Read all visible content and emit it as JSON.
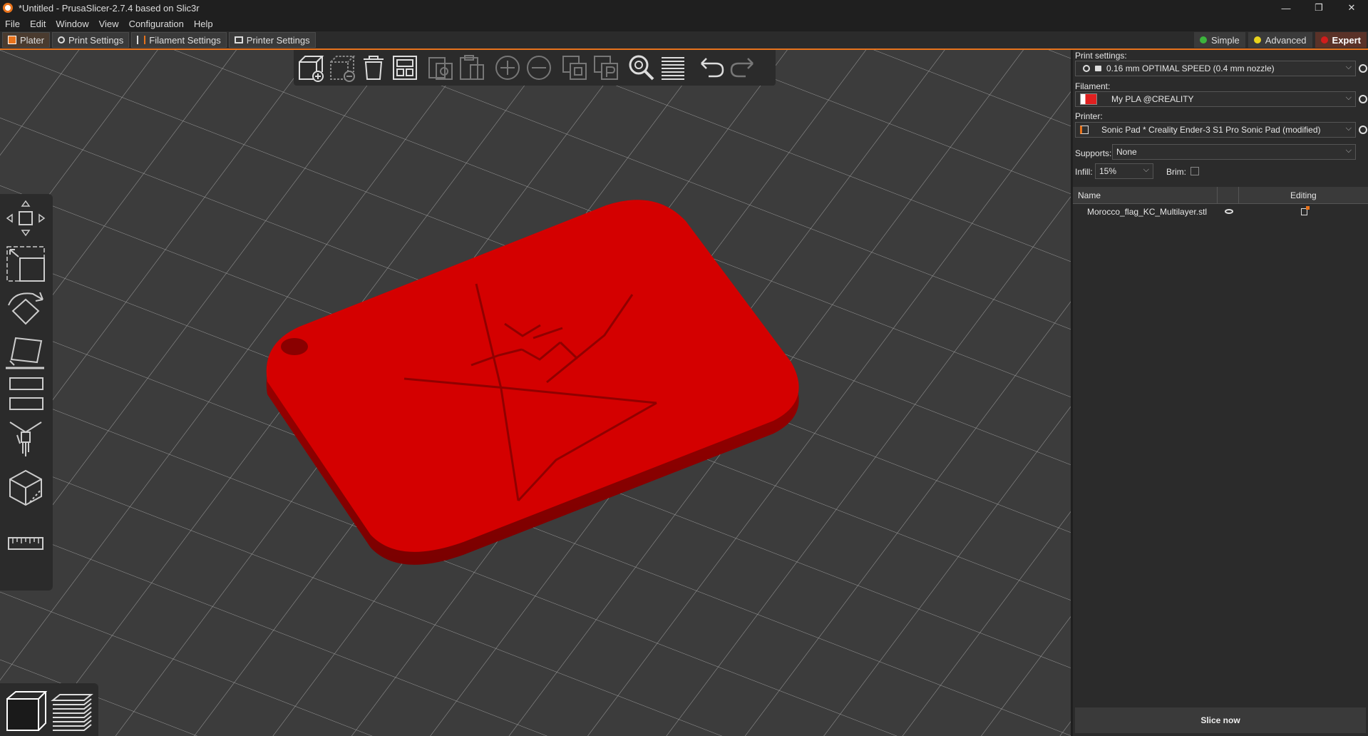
{
  "window": {
    "title": "*Untitled - PrusaSlicer-2.7.4 based on Slic3r",
    "controls": [
      "—",
      "❐",
      "✕"
    ]
  },
  "menu": [
    "File",
    "Edit",
    "Window",
    "View",
    "Configuration",
    "Help"
  ],
  "tabs": [
    {
      "label": "Plater",
      "icon": "plater-icon",
      "active": true
    },
    {
      "label": "Print Settings",
      "icon": "gear-icon"
    },
    {
      "label": "Filament Settings",
      "icon": "filament-icon"
    },
    {
      "label": "Printer Settings",
      "icon": "printer-icon"
    }
  ],
  "modes": [
    {
      "label": "Simple",
      "color": "#3cb43c"
    },
    {
      "label": "Advanced",
      "color": "#e8d21c"
    },
    {
      "label": "Expert",
      "color": "#d21c1c",
      "active": true
    }
  ],
  "top_toolbar_icons": [
    "add-icon",
    "delete-icon",
    "delete-all-icon",
    "arrange-icon",
    "copy-icon",
    "paste-icon",
    "add-instance-icon",
    "remove-instance-icon",
    "split-objects-icon",
    "split-parts-icon",
    "search-icon",
    "layers-editing-icon",
    "undo-icon",
    "redo-icon"
  ],
  "left_toolbar_icons": [
    "move-icon",
    "scale-icon",
    "rotate-icon",
    "place-on-face-icon",
    "cut-icon",
    "paint-supports-icon",
    "seam-painting-icon",
    "measure-icon"
  ],
  "bottom_toolbar_icons": [
    "3d-view-icon",
    "preview-icon"
  ],
  "sidebar": {
    "print_settings_label": "Print settings:",
    "print_settings_value": "0.16 mm OPTIMAL SPEED (0.4 mm nozzle)",
    "filament_label": "Filament:",
    "filament_value": "My PLA @CREALITY",
    "filament_color": "#e02020",
    "printer_label": "Printer:",
    "printer_value": "Sonic Pad * Creality Ender-3 S1 Pro Sonic Pad (modified)",
    "supports_label": "Supports:",
    "supports_value": "None",
    "infill_label": "Infill:",
    "infill_value": "15%",
    "brim_label": "Brim:",
    "brim_checked": false
  },
  "object_list": {
    "columns": [
      "Name",
      "Editing"
    ],
    "rows": [
      {
        "name": "Morocco_flag_KC_Multilayer.stl"
      }
    ]
  },
  "slice_button": "Slice now",
  "model": {
    "color": "#d40000"
  }
}
